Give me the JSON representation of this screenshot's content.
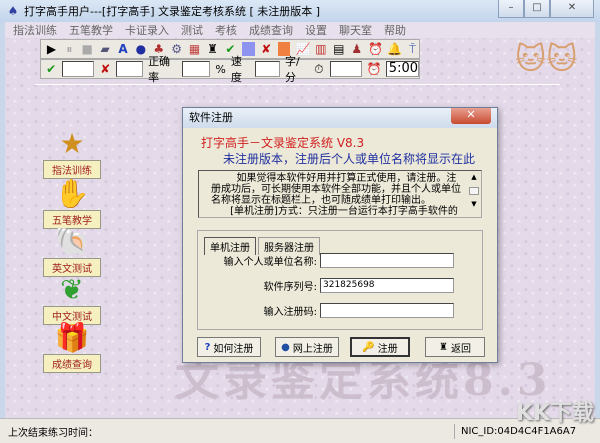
{
  "window": {
    "title": "打字高手用户---[打字高手]    文录鉴定考核系统 [ 未注册版本 ]",
    "min": "–",
    "max": "□",
    "close": "✕"
  },
  "menu": [
    "指法训练",
    "五笔教学",
    "卡证录入",
    "测试",
    "考核",
    "成绩查询",
    "设置",
    "聊天室",
    "帮助"
  ],
  "stats": {
    "percent": "%",
    "accuracy_label": "正确率",
    "speed_label": "速度",
    "speed_unit": "字/分",
    "timer": "5:00"
  },
  "sidebar": [
    "指法训练",
    "五笔教学",
    "英文测试",
    "中文测试",
    "成绩查询"
  ],
  "dialog": {
    "title": "软件注册",
    "heading": "打字高手－文录鉴定系统 V8.3",
    "notice": "未注册版本，注册后个人或单位名称将显示在此",
    "info": "        如果觉得本软件好用并打算正式使用，请注册。注册成功后，可长期使用本软件全部功能，并且个人或单位名称将显示在标题栏上，也可随成绩单打印输出。\n      [单机注册]方式：只注册一台运行本打字高手软件的",
    "tabs": [
      "单机注册",
      "服务器注册"
    ],
    "name_label": "输入个人或单位名称:",
    "name_value": "",
    "serial_label": "软件序列号:",
    "serial_value": "321825698",
    "code_label": "输入注册码:",
    "code_value": "",
    "buttons": [
      "如何注册",
      "网上注册",
      "注册",
      "返回"
    ]
  },
  "background_text": "文录鉴定系统8.3",
  "status": {
    "last_time_label": "上次结束练习时间：",
    "nic": "NIC_ID:04D4C4F1A6A7"
  },
  "watermark": "KK下载"
}
